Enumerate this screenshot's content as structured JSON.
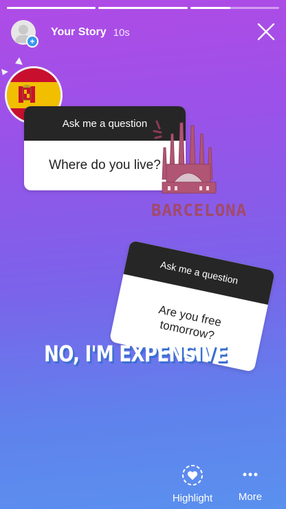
{
  "story": {
    "username": "Your Story",
    "time_ago": "10s",
    "progress": [
      1.0,
      1.0,
      0.45
    ]
  },
  "stickers": {
    "question1": {
      "header": "Ask me a question",
      "body": "Where do you live?"
    },
    "question2": {
      "header": "Ask me a question",
      "body": "Are you free tomorrow?"
    },
    "barcelona_text": "BARCELONA"
  },
  "caption": "NO, I'M EXPENSIVE",
  "footer": {
    "highlight_label": "Highlight",
    "more_label": "More"
  },
  "icons": {
    "close": "close-icon",
    "highlight": "highlight-heart-icon",
    "more": "more-dots-icon"
  },
  "colors": {
    "accent_blue": "#3897f0",
    "card_header": "#262626",
    "barcelona": "#a24a66",
    "gradient_top": "#b04be6",
    "gradient_bottom": "#5a90ee"
  }
}
